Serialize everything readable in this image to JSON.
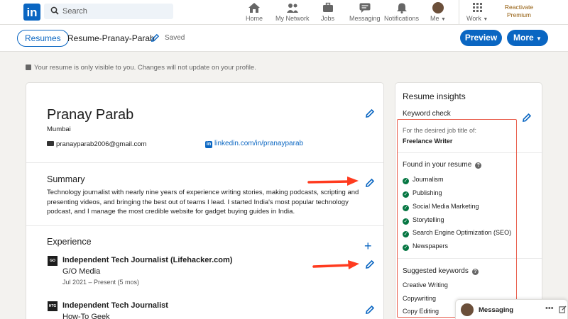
{
  "nav": {
    "logo": "in",
    "search_placeholder": "Search",
    "items": [
      "Home",
      "My Network",
      "Jobs",
      "Messaging",
      "Notifications",
      "Me",
      "Work"
    ],
    "premium": "Reactivate Premium"
  },
  "subbar": {
    "resumes_label": "Resumes",
    "resume_name": "Resume-Pranay-Parab",
    "saved": "Saved",
    "preview": "Preview",
    "more": "More"
  },
  "notice": "Your resume is only visible to you. Changes will not update on your profile.",
  "profile": {
    "name": "Pranay Parab",
    "city": "Mumbai",
    "email": "pranayparab2006@gmail.com",
    "linkedin": "linkedin.com/in/pranayparab"
  },
  "summary": {
    "title": "Summary",
    "text": "Technology journalist with nearly nine years of experience writing stories, making podcasts, scripting and presenting videos, and bringing the best out of teams I lead. I started India's most popular technology podcast, and I manage the most credible website for gadget buying guides in India."
  },
  "experience": {
    "title": "Experience",
    "items": [
      {
        "logo": "GO",
        "title": "Independent Tech Journalist (Lifehacker.com)",
        "company": "G/O Media",
        "dates": "Jul 2021 – Present (5 mos)"
      },
      {
        "logo": "HTG",
        "title": "Independent Tech Journalist",
        "company": "How-To Geek",
        "dates": ""
      }
    ]
  },
  "insights": {
    "title": "Resume insights",
    "keyword_check": "Keyword check",
    "desired_label": "For the desired job title of:",
    "desired_value": "Freelance Writer",
    "found_title": "Found in your resume",
    "found": [
      "Journalism",
      "Publishing",
      "Social Media Marketing",
      "Storytelling",
      "Search Engine Optimization (SEO)",
      "Newspapers"
    ],
    "suggested_title": "Suggested keywords",
    "suggested": [
      "Creative Writing",
      "Copywriting",
      "Copy Editing"
    ]
  },
  "messaging": {
    "label": "Messaging"
  },
  "colors": {
    "brand": "#0a66c2",
    "check": "#057642",
    "annotation": "#e9604f",
    "premium": "#915907"
  }
}
